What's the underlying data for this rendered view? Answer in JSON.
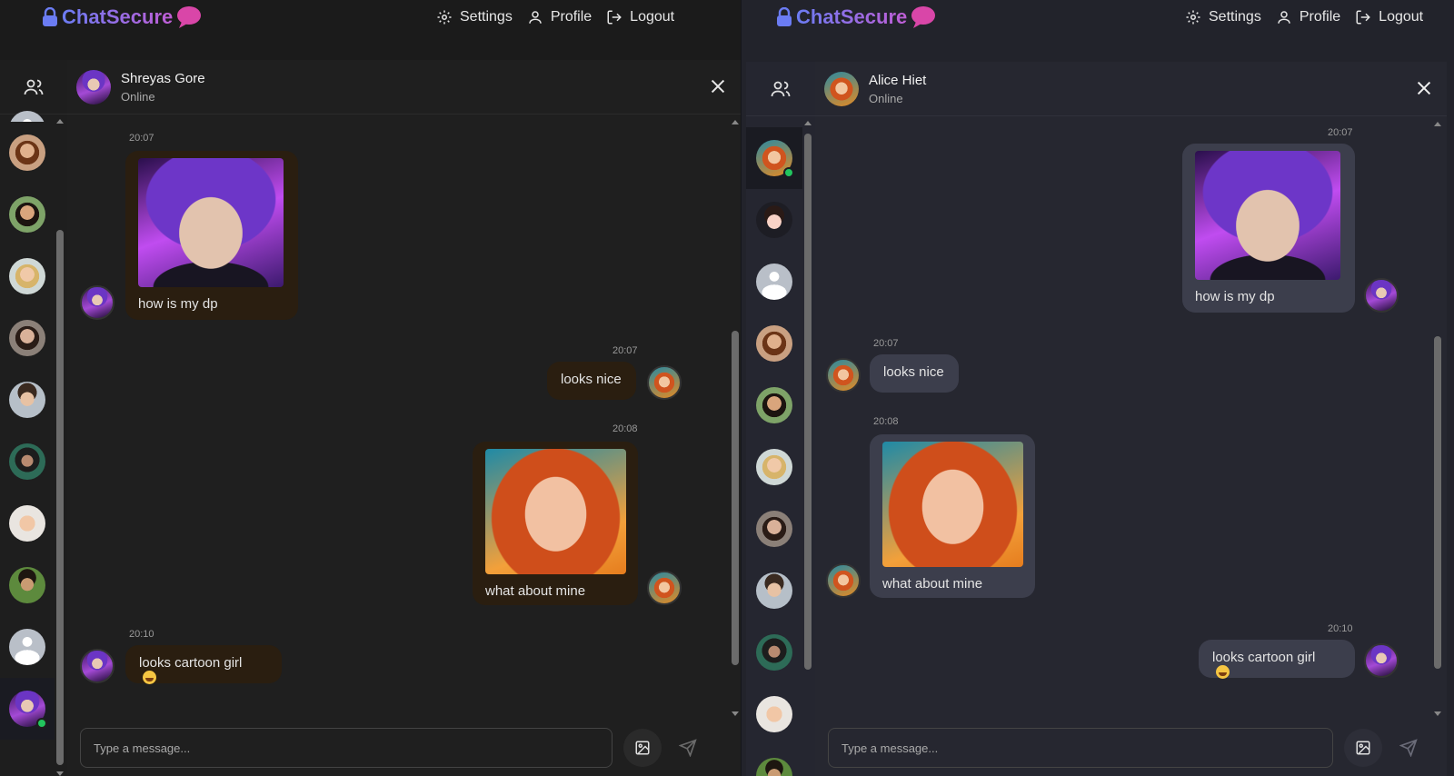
{
  "app": {
    "brand": "ChatSecure",
    "accent_from": "#6b7cf3",
    "accent_to": "#c05ed6"
  },
  "nav": {
    "settings": "Settings",
    "profile": "Profile",
    "logout": "Logout"
  },
  "left": {
    "theme": "dark-brown",
    "chat_header": {
      "name": "Shreyas Gore",
      "status": "Online"
    },
    "messages": [
      {
        "time": "20:07",
        "text": "how is my dp",
        "image": "anime-boy",
        "side": "incoming"
      },
      {
        "time": "20:07",
        "text": "looks nice",
        "side": "outgoing"
      },
      {
        "time": "20:08",
        "text": "what about mine",
        "image": "redhead-girl",
        "side": "outgoing"
      },
      {
        "time": "20:10",
        "text": "looks cartoon girl",
        "emoji": "joy-emoji",
        "side": "incoming"
      }
    ],
    "composer": {
      "placeholder": "Type a message..."
    }
  },
  "right": {
    "theme": "dark-slate",
    "chat_header": {
      "name": "Alice Hiet",
      "status": "Online"
    },
    "messages": [
      {
        "time": "20:07",
        "text": "how is my dp",
        "image": "anime-boy",
        "side": "outgoing"
      },
      {
        "time": "20:07",
        "text": "looks nice",
        "side": "incoming"
      },
      {
        "time": "20:08",
        "text": "what about mine",
        "image": "redhead-girl",
        "side": "incoming"
      },
      {
        "time": "20:10",
        "text": "looks cartoon girl",
        "emoji": "joy-emoji",
        "side": "outgoing"
      }
    ],
    "composer": {
      "placeholder": "Type a message..."
    }
  },
  "icons": {
    "logo_lock": "lock-icon",
    "logo_bubble": "chat-bubble-icon",
    "settings": "gear-icon",
    "profile": "user-icon",
    "logout": "logout-icon",
    "contacts": "users-icon",
    "close": "close-icon",
    "image": "image-icon",
    "send": "send-icon"
  },
  "colors": {
    "online": "#22c55e",
    "left_bubble": "#2a1e10",
    "right_bubble": "#3c3e4c"
  }
}
